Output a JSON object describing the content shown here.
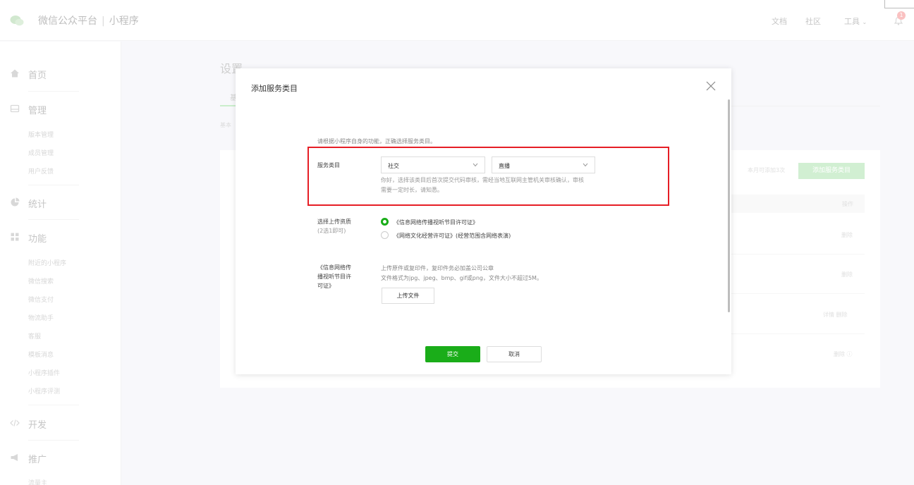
{
  "header": {
    "brand": "微信公众平台",
    "separator": "|",
    "product": "小程序",
    "nav": [
      "文档",
      "社区",
      "工具"
    ],
    "notification_count": "1"
  },
  "sidebar": {
    "groups": [
      {
        "label": "首页",
        "icon": "home-icon",
        "items": []
      },
      {
        "label": "管理",
        "icon": "manage-icon",
        "items": [
          "版本管理",
          "成员管理",
          "用户反馈"
        ]
      },
      {
        "label": "统计",
        "icon": "stats-icon",
        "items": []
      },
      {
        "label": "功能",
        "icon": "features-icon",
        "items": [
          "附近的小程序",
          "微信搜索",
          "微信支付",
          "物流助手",
          "客服",
          "模板消息",
          "小程序插件",
          "小程序评测"
        ]
      },
      {
        "label": "开发",
        "icon": "code-icon",
        "items": []
      },
      {
        "label": "推广",
        "icon": "promote-icon",
        "items": [
          "流量主"
        ]
      }
    ]
  },
  "page": {
    "title": "设置",
    "tab": "基",
    "subtext": "基本",
    "quota": "本月可添加3次",
    "add_category_button": "添加服务类目",
    "table_header_action": "操作",
    "row_actions": [
      "删除",
      "删除",
      "详情 删除",
      "删除"
    ]
  },
  "dialog": {
    "title": "添加服务类目",
    "intro": "请根据小程序自身的功能，正确选择服务类目。",
    "category_label": "服务类目",
    "category_primary": "社交",
    "category_secondary": "直播",
    "category_hint_line1": "你好，选择该类目后首次提交代码审核，需经当地互联网主管机关审核确认，审核",
    "category_hint_line2": "需要一定时长，请知悉。",
    "qualification_label_line1": "选择上传资质",
    "qualification_label_line2": "(2选1即可)",
    "option1": "《信息网络传播视听节目许可证》",
    "option2": "《网络文化经营许可证》(经营范围含网络表演)",
    "license_label_line1": "《信息网络传",
    "license_label_line2": "播视听节目许",
    "license_label_line3": "可证》",
    "upload_desc_line1": "上传原件或复印件，复印件务必加盖公司公章",
    "upload_desc_line2": "文件格式为jpg、jpeg、bmp、gif或png，文件大小不超过5M。",
    "upload_button": "上传文件",
    "submit_button": "提交",
    "cancel_button": "取消"
  },
  "colors": {
    "primary_green": "#1aad19",
    "highlight_red": "#e61e25"
  }
}
